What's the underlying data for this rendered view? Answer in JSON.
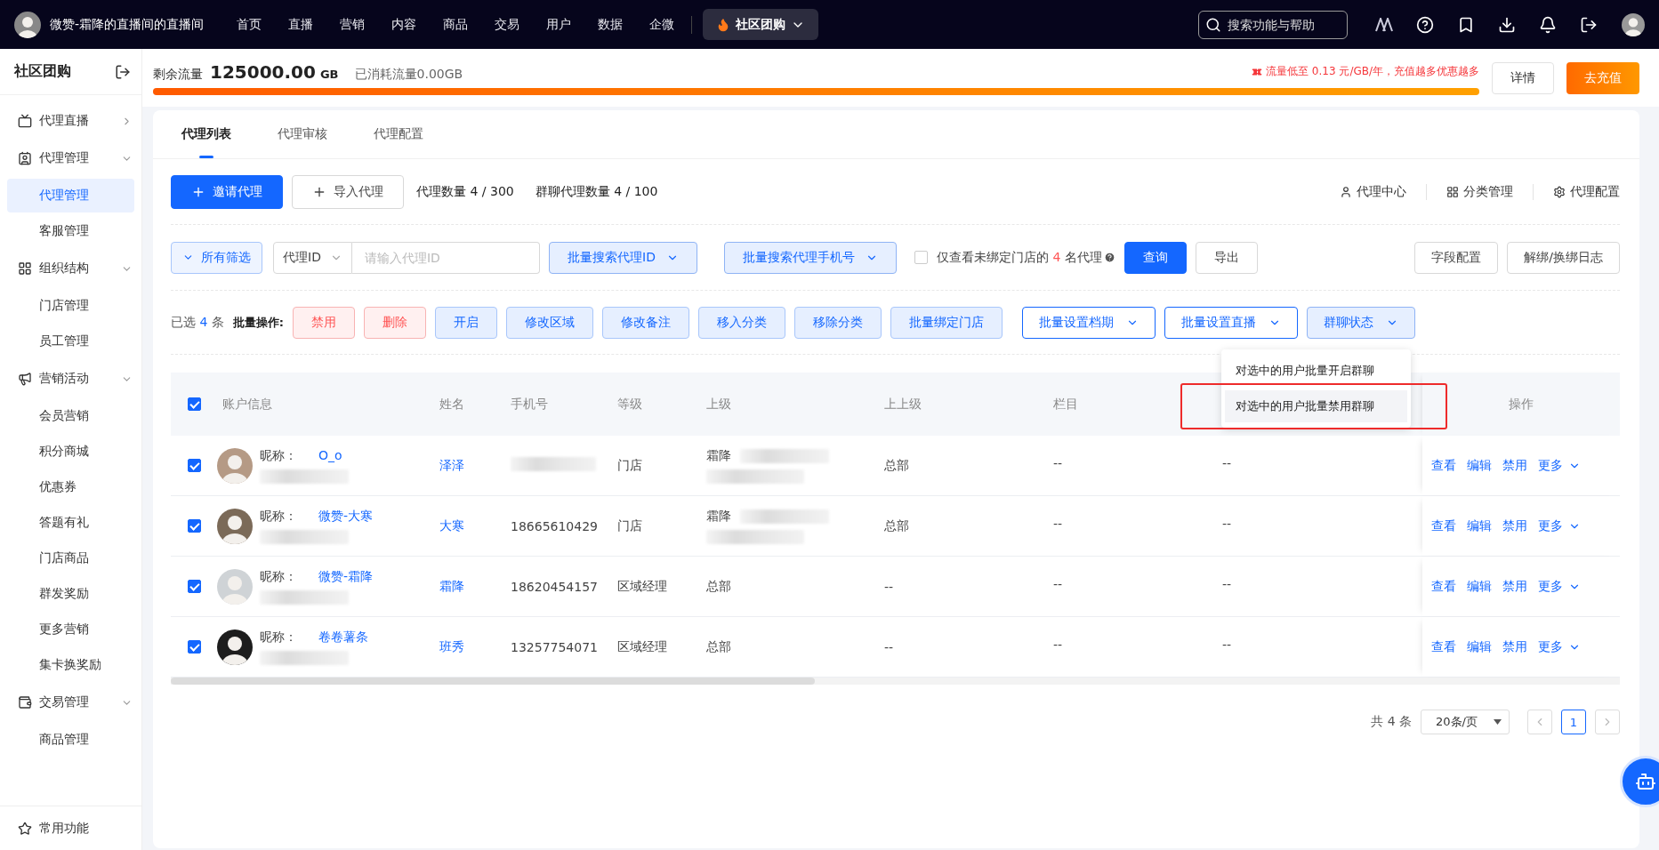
{
  "topbar": {
    "shop_name": "微赞-霜降的直播间的直播间",
    "nav": [
      {
        "label": "首页",
        "selected": false
      },
      {
        "label": "直播",
        "selected": false
      },
      {
        "label": "营销",
        "selected": false
      },
      {
        "label": "内容",
        "selected": false
      },
      {
        "label": "商品",
        "selected": false
      },
      {
        "label": "交易",
        "selected": false
      },
      {
        "label": "用户",
        "selected": false
      },
      {
        "label": "数据",
        "selected": false
      },
      {
        "label": "企微",
        "selected": false
      },
      {
        "label": "社区团购",
        "selected": true
      }
    ],
    "search": {
      "placeholder": "搜索功能与帮助"
    }
  },
  "sidebar": {
    "title": "社区团购",
    "sections": [
      {
        "label": "代理直播",
        "expanded": false
      },
      {
        "label": "代理管理",
        "expanded": true,
        "children": [
          {
            "label": "代理管理",
            "selected": true
          },
          {
            "label": "客服管理",
            "selected": false
          }
        ]
      },
      {
        "label": "组织结构",
        "expanded": true,
        "children": [
          {
            "label": "门店管理",
            "selected": false
          },
          {
            "label": "员工管理",
            "selected": false
          }
        ]
      },
      {
        "label": "营销活动",
        "expanded": true,
        "children": [
          {
            "label": "会员营销",
            "selected": false
          },
          {
            "label": "积分商城",
            "selected": false
          },
          {
            "label": "优惠券",
            "selected": false
          },
          {
            "label": "答题有礼",
            "selected": false
          },
          {
            "label": "门店商品",
            "selected": false
          },
          {
            "label": "群发奖励",
            "selected": false
          },
          {
            "label": "更多营销",
            "selected": false
          },
          {
            "label": "集卡换奖励",
            "selected": false
          }
        ]
      },
      {
        "label": "交易管理",
        "expanded": true,
        "children": [
          {
            "label": "商品管理",
            "selected": false
          }
        ]
      }
    ],
    "footer": "常用功能"
  },
  "traffic": {
    "label": "剩余流量",
    "value": "125000.00",
    "unit": "GB",
    "used": "已消耗流量0.00GB",
    "level": 1,
    "promo": "流量低至 0.13 元/GB/年，充值越多优惠越多",
    "buttons": [
      {
        "label": "详情",
        "kind": "plain"
      },
      {
        "label": "去充值",
        "kind": "primary"
      }
    ]
  },
  "tabs": [
    {
      "label": "代理列表",
      "selected": true
    },
    {
      "label": "代理审核",
      "selected": false
    },
    {
      "label": "代理配置",
      "selected": false
    }
  ],
  "toolbar": {
    "buttons": [
      {
        "label": "邀请代理",
        "kind": "primary"
      },
      {
        "label": "导入代理",
        "kind": "plain"
      }
    ],
    "stats": [
      "代理数量 4 / 300",
      "群聊代理数量 4 / 100"
    ],
    "links": [
      "代理中心",
      "分类管理",
      "代理配置"
    ]
  },
  "filters": {
    "all_filters": "所有筛选",
    "field_select": "代理ID",
    "input": {
      "placeholder": "请输入代理ID"
    },
    "dropdowns": [
      "批量搜索代理ID",
      "批量搜索代理手机号"
    ],
    "unbound": {
      "checked": false,
      "before": "仅查看未绑定门店的",
      "count": "4",
      "after": "名代理"
    },
    "query": "查询",
    "export": "导出",
    "right_buttons": [
      "字段配置",
      "解绑/换绑日志"
    ]
  },
  "batch": {
    "selected_prefix": "已选",
    "selected_count": "4",
    "selected_suffix": "条",
    "label": "批量操作:",
    "buttons": [
      {
        "label": "禁用",
        "kind": "danger"
      },
      {
        "label": "删除",
        "kind": "danger"
      },
      {
        "label": "开启",
        "kind": "light"
      },
      {
        "label": "修改区域",
        "kind": "light"
      },
      {
        "label": "修改备注",
        "kind": "light"
      },
      {
        "label": "移入分类",
        "kind": "light"
      },
      {
        "label": "移除分类",
        "kind": "light"
      },
      {
        "label": "批量绑定门店",
        "kind": "light"
      },
      {
        "label": "批量设置档期",
        "kind": "dropdown",
        "expanded": false
      },
      {
        "label": "批量设置直播",
        "kind": "dropdown",
        "expanded": false
      },
      {
        "label": "群聊状态",
        "kind": "dropdown",
        "expanded": true
      }
    ],
    "menu": [
      {
        "label": "对选中的用户批量开启群聊",
        "highlighted": false
      },
      {
        "label": "对选中的用户批量禁用群聊",
        "highlighted": true
      }
    ]
  },
  "table": {
    "all_checked": true,
    "columns": [
      "账户信息",
      "姓名",
      "手机号",
      "等级",
      "上级",
      "上上级",
      "栏目"
    ],
    "action_column": "操作",
    "rows": [
      {
        "checked": true,
        "nickname_label": "昵称：",
        "nickname": "O_o",
        "name": "泽泽",
        "phone_blurred": true,
        "level": "门店",
        "parent": "霜降",
        "parent_blurred": true,
        "grandparent": "总部",
        "column": "--",
        "column_9": "--",
        "actions": [
          "查看",
          "编辑",
          "禁用",
          "更多"
        ]
      },
      {
        "checked": true,
        "nickname_label": "昵称：",
        "nickname": "微赞-大寒",
        "name": "大寒",
        "phone": "18665610429",
        "phone_blurred": false,
        "level": "门店",
        "parent": "霜降",
        "parent_blurred": true,
        "grandparent": "总部",
        "column": "--",
        "column_9": "--",
        "actions": [
          "查看",
          "编辑",
          "禁用",
          "更多"
        ]
      },
      {
        "checked": true,
        "nickname_label": "昵称：",
        "nickname": "微赞-霜降",
        "name": "霜降",
        "phone": "18620454157",
        "phone_blurred": false,
        "level": "区域经理",
        "parent": "总部",
        "parent_blurred": false,
        "grandparent": "--",
        "column": "--",
        "column_9": "--",
        "actions": [
          "查看",
          "编辑",
          "禁用",
          "更多"
        ]
      },
      {
        "checked": true,
        "nickname_label": "昵称：",
        "nickname": "卷卷薯条",
        "name": "班秀",
        "phone": "13257754071",
        "phone_blurred": false,
        "level": "区域经理",
        "parent": "总部",
        "parent_blurred": false,
        "grandparent": "--",
        "column": "--",
        "column_9": "--",
        "actions": [
          "查看",
          "编辑",
          "禁用",
          "更多"
        ]
      }
    ]
  },
  "pagination": {
    "total": "共 4 条",
    "page_size": "20条/页",
    "pages": [
      {
        "label": "1",
        "selected": true
      }
    ]
  }
}
